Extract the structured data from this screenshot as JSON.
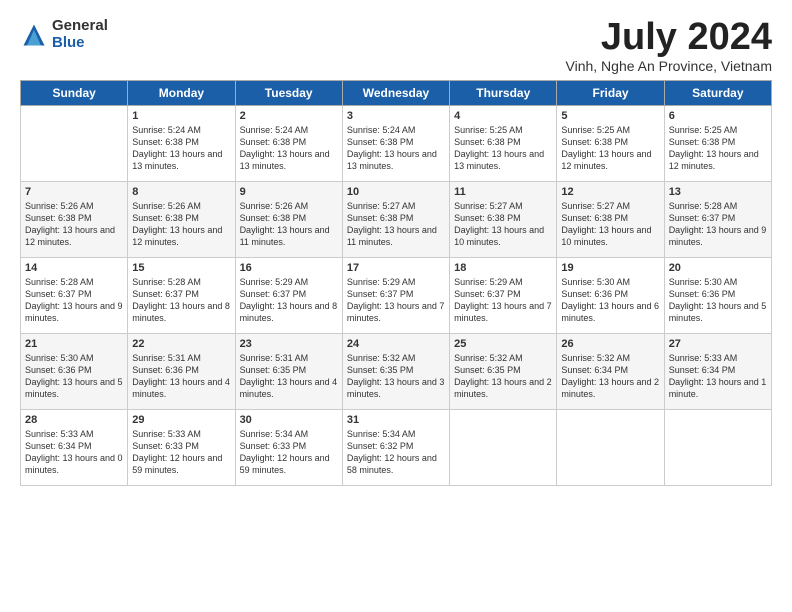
{
  "header": {
    "logo_general": "General",
    "logo_blue": "Blue",
    "month_title": "July 2024",
    "location": "Vinh, Nghe An Province, Vietnam"
  },
  "days_of_week": [
    "Sunday",
    "Monday",
    "Tuesday",
    "Wednesday",
    "Thursday",
    "Friday",
    "Saturday"
  ],
  "weeks": [
    [
      {
        "day": "",
        "sunrise": "",
        "sunset": "",
        "daylight": ""
      },
      {
        "day": "1",
        "sunrise": "Sunrise: 5:24 AM",
        "sunset": "Sunset: 6:38 PM",
        "daylight": "Daylight: 13 hours and 13 minutes."
      },
      {
        "day": "2",
        "sunrise": "Sunrise: 5:24 AM",
        "sunset": "Sunset: 6:38 PM",
        "daylight": "Daylight: 13 hours and 13 minutes."
      },
      {
        "day": "3",
        "sunrise": "Sunrise: 5:24 AM",
        "sunset": "Sunset: 6:38 PM",
        "daylight": "Daylight: 13 hours and 13 minutes."
      },
      {
        "day": "4",
        "sunrise": "Sunrise: 5:25 AM",
        "sunset": "Sunset: 6:38 PM",
        "daylight": "Daylight: 13 hours and 13 minutes."
      },
      {
        "day": "5",
        "sunrise": "Sunrise: 5:25 AM",
        "sunset": "Sunset: 6:38 PM",
        "daylight": "Daylight: 13 hours and 12 minutes."
      },
      {
        "day": "6",
        "sunrise": "Sunrise: 5:25 AM",
        "sunset": "Sunset: 6:38 PM",
        "daylight": "Daylight: 13 hours and 12 minutes."
      }
    ],
    [
      {
        "day": "7",
        "sunrise": "Sunrise: 5:26 AM",
        "sunset": "Sunset: 6:38 PM",
        "daylight": "Daylight: 13 hours and 12 minutes."
      },
      {
        "day": "8",
        "sunrise": "Sunrise: 5:26 AM",
        "sunset": "Sunset: 6:38 PM",
        "daylight": "Daylight: 13 hours and 12 minutes."
      },
      {
        "day": "9",
        "sunrise": "Sunrise: 5:26 AM",
        "sunset": "Sunset: 6:38 PM",
        "daylight": "Daylight: 13 hours and 11 minutes."
      },
      {
        "day": "10",
        "sunrise": "Sunrise: 5:27 AM",
        "sunset": "Sunset: 6:38 PM",
        "daylight": "Daylight: 13 hours and 11 minutes."
      },
      {
        "day": "11",
        "sunrise": "Sunrise: 5:27 AM",
        "sunset": "Sunset: 6:38 PM",
        "daylight": "Daylight: 13 hours and 10 minutes."
      },
      {
        "day": "12",
        "sunrise": "Sunrise: 5:27 AM",
        "sunset": "Sunset: 6:38 PM",
        "daylight": "Daylight: 13 hours and 10 minutes."
      },
      {
        "day": "13",
        "sunrise": "Sunrise: 5:28 AM",
        "sunset": "Sunset: 6:37 PM",
        "daylight": "Daylight: 13 hours and 9 minutes."
      }
    ],
    [
      {
        "day": "14",
        "sunrise": "Sunrise: 5:28 AM",
        "sunset": "Sunset: 6:37 PM",
        "daylight": "Daylight: 13 hours and 9 minutes."
      },
      {
        "day": "15",
        "sunrise": "Sunrise: 5:28 AM",
        "sunset": "Sunset: 6:37 PM",
        "daylight": "Daylight: 13 hours and 8 minutes."
      },
      {
        "day": "16",
        "sunrise": "Sunrise: 5:29 AM",
        "sunset": "Sunset: 6:37 PM",
        "daylight": "Daylight: 13 hours and 8 minutes."
      },
      {
        "day": "17",
        "sunrise": "Sunrise: 5:29 AM",
        "sunset": "Sunset: 6:37 PM",
        "daylight": "Daylight: 13 hours and 7 minutes."
      },
      {
        "day": "18",
        "sunrise": "Sunrise: 5:29 AM",
        "sunset": "Sunset: 6:37 PM",
        "daylight": "Daylight: 13 hours and 7 minutes."
      },
      {
        "day": "19",
        "sunrise": "Sunrise: 5:30 AM",
        "sunset": "Sunset: 6:36 PM",
        "daylight": "Daylight: 13 hours and 6 minutes."
      },
      {
        "day": "20",
        "sunrise": "Sunrise: 5:30 AM",
        "sunset": "Sunset: 6:36 PM",
        "daylight": "Daylight: 13 hours and 5 minutes."
      }
    ],
    [
      {
        "day": "21",
        "sunrise": "Sunrise: 5:30 AM",
        "sunset": "Sunset: 6:36 PM",
        "daylight": "Daylight: 13 hours and 5 minutes."
      },
      {
        "day": "22",
        "sunrise": "Sunrise: 5:31 AM",
        "sunset": "Sunset: 6:36 PM",
        "daylight": "Daylight: 13 hours and 4 minutes."
      },
      {
        "day": "23",
        "sunrise": "Sunrise: 5:31 AM",
        "sunset": "Sunset: 6:35 PM",
        "daylight": "Daylight: 13 hours and 4 minutes."
      },
      {
        "day": "24",
        "sunrise": "Sunrise: 5:32 AM",
        "sunset": "Sunset: 6:35 PM",
        "daylight": "Daylight: 13 hours and 3 minutes."
      },
      {
        "day": "25",
        "sunrise": "Sunrise: 5:32 AM",
        "sunset": "Sunset: 6:35 PM",
        "daylight": "Daylight: 13 hours and 2 minutes."
      },
      {
        "day": "26",
        "sunrise": "Sunrise: 5:32 AM",
        "sunset": "Sunset: 6:34 PM",
        "daylight": "Daylight: 13 hours and 2 minutes."
      },
      {
        "day": "27",
        "sunrise": "Sunrise: 5:33 AM",
        "sunset": "Sunset: 6:34 PM",
        "daylight": "Daylight: 13 hours and 1 minute."
      }
    ],
    [
      {
        "day": "28",
        "sunrise": "Sunrise: 5:33 AM",
        "sunset": "Sunset: 6:34 PM",
        "daylight": "Daylight: 13 hours and 0 minutes."
      },
      {
        "day": "29",
        "sunrise": "Sunrise: 5:33 AM",
        "sunset": "Sunset: 6:33 PM",
        "daylight": "Daylight: 12 hours and 59 minutes."
      },
      {
        "day": "30",
        "sunrise": "Sunrise: 5:34 AM",
        "sunset": "Sunset: 6:33 PM",
        "daylight": "Daylight: 12 hours and 59 minutes."
      },
      {
        "day": "31",
        "sunrise": "Sunrise: 5:34 AM",
        "sunset": "Sunset: 6:32 PM",
        "daylight": "Daylight: 12 hours and 58 minutes."
      },
      {
        "day": "",
        "sunrise": "",
        "sunset": "",
        "daylight": ""
      },
      {
        "day": "",
        "sunrise": "",
        "sunset": "",
        "daylight": ""
      },
      {
        "day": "",
        "sunrise": "",
        "sunset": "",
        "daylight": ""
      }
    ]
  ]
}
